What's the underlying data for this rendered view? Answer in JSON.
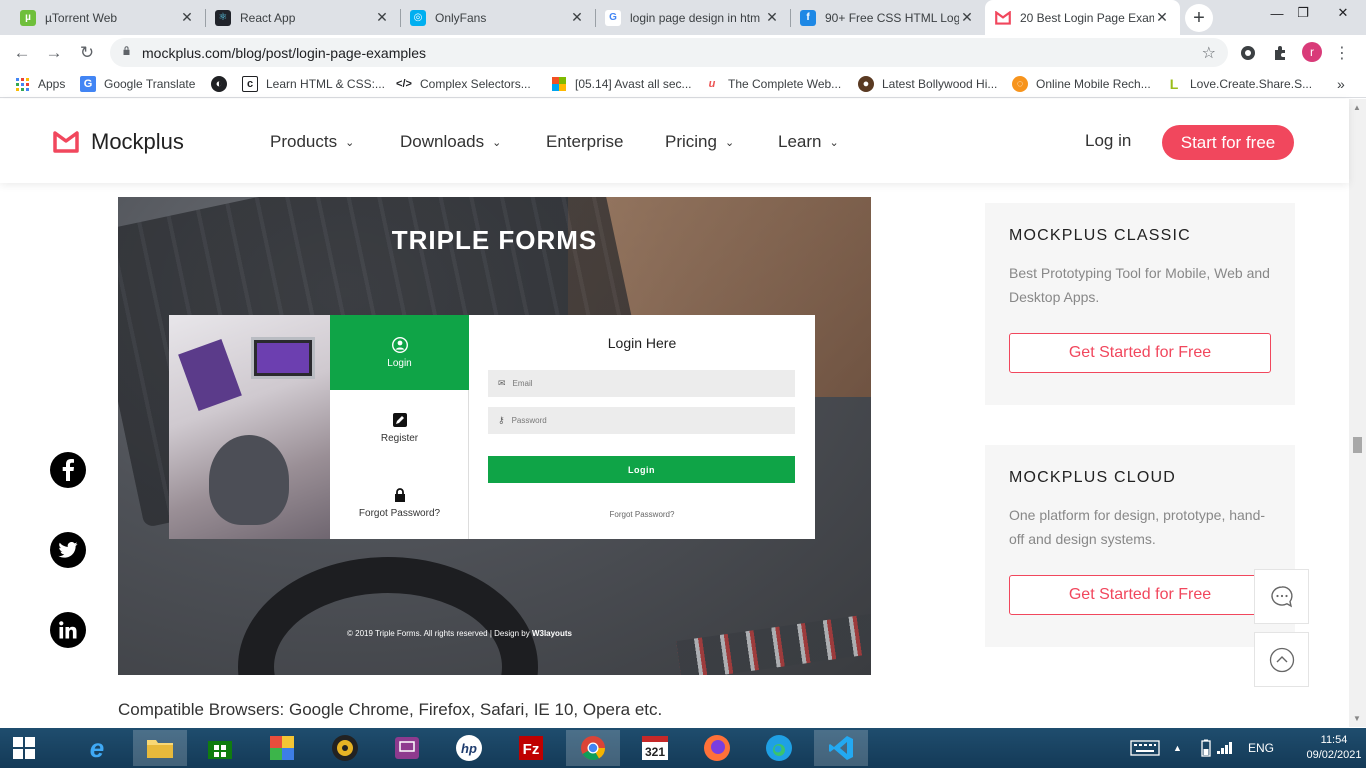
{
  "browser": {
    "tabs": [
      {
        "title": "µTorrent Web",
        "icon": "utorrent-icon",
        "color": "#6fbf3b",
        "glyph": "µ"
      },
      {
        "title": "React App",
        "icon": "react-icon",
        "color": "#20232a",
        "glyph": "⚛"
      },
      {
        "title": "OnlyFans",
        "icon": "onlyfans-icon",
        "color": "#00aff0",
        "glyph": "◎"
      },
      {
        "title": "login page design in htm",
        "icon": "google-icon",
        "color": "#ffffff",
        "glyph": "G"
      },
      {
        "title": "90+ Free CSS HTML Log",
        "icon": "freefrontend-icon",
        "color": "#1e88e5",
        "glyph": "f"
      },
      {
        "title": "20 Best Login Page Exam",
        "icon": "mockplus-icon",
        "color": "#ffffff",
        "glyph": "M"
      }
    ],
    "url": "mockplus.com/blog/post/login-page-examples",
    "avatar_letter": "r",
    "bookmarks": [
      {
        "label": "Apps",
        "icon": "apps-grid-icon"
      },
      {
        "label": "Google Translate",
        "icon": "google-translate-icon"
      },
      {
        "label": "",
        "icon": "globe-icon"
      },
      {
        "label": "Learn HTML & CSS:...",
        "icon": "page-icon"
      },
      {
        "label": "Complex Selectors...",
        "icon": "code-icon"
      },
      {
        "label": "[05.14] Avast all sec...",
        "icon": "avast-icon"
      },
      {
        "label": "The Complete Web...",
        "icon": "udemy-icon"
      },
      {
        "label": "Latest Bollywood Hi...",
        "icon": "bollywood-icon"
      },
      {
        "label": "Online Mobile Rech...",
        "icon": "recharge-icon"
      },
      {
        "label": "Love.Create.Share.S...",
        "icon": "lcs-icon"
      }
    ]
  },
  "site": {
    "brand": "Mockplus",
    "brand_color": "#f1475d",
    "nav": [
      {
        "label": "Products",
        "dropdown": true
      },
      {
        "label": "Downloads",
        "dropdown": true
      },
      {
        "label": "Enterprise",
        "dropdown": false
      },
      {
        "label": "Pricing",
        "dropdown": true
      },
      {
        "label": "Learn",
        "dropdown": true
      }
    ],
    "login": "Log in",
    "start": "Start for free"
  },
  "hero": {
    "title": "TRIPLE FORMS",
    "menu": [
      "Login",
      "Register",
      "Forgot Password?"
    ],
    "login_heading": "Login Here",
    "email_placeholder": "Email",
    "password_placeholder": "Password",
    "login_button": "Login",
    "forgot": "Forgot Password?",
    "footer_text": "© 2019 Triple Forms. All rights reserved | Design by ",
    "footer_brand": "W3layouts"
  },
  "caption": "Compatible Browsers: Google Chrome, Firefox, Safari, IE 10, Opera etc.",
  "cards": [
    {
      "title": "MOCKPLUS CLASSIC",
      "desc": "Best Prototyping Tool for Mobile, Web and Desktop Apps.",
      "cta": "Get Started for Free"
    },
    {
      "title": "MOCKPLUS CLOUD",
      "desc": "One platform for design, prototype, hand-off and design systems.",
      "cta": "Get Started for Free"
    }
  ],
  "taskbar": {
    "lang": "ENG",
    "time": "11:54",
    "date": "09/02/2021"
  }
}
